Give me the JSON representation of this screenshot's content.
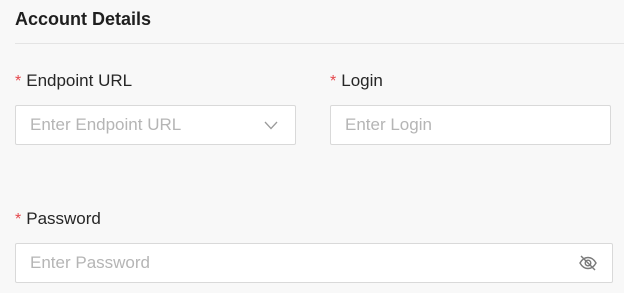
{
  "section": {
    "title": "Account Details"
  },
  "fields": {
    "endpoint": {
      "required_mark": "*",
      "label": "Endpoint URL",
      "value": "",
      "placeholder": "Enter Endpoint URL",
      "icon": "chevron-down-icon"
    },
    "login": {
      "required_mark": "*",
      "label": "Login",
      "value": "",
      "placeholder": "Enter Login"
    },
    "password": {
      "required_mark": "*",
      "label": "Password",
      "value": "",
      "placeholder": "Enter Password",
      "icon": "eye-off-icon"
    }
  },
  "colors": {
    "required": "#e5484d",
    "placeholder": "#b5b5b5",
    "border": "#d9d9d9",
    "background": "#f8f8f8"
  }
}
